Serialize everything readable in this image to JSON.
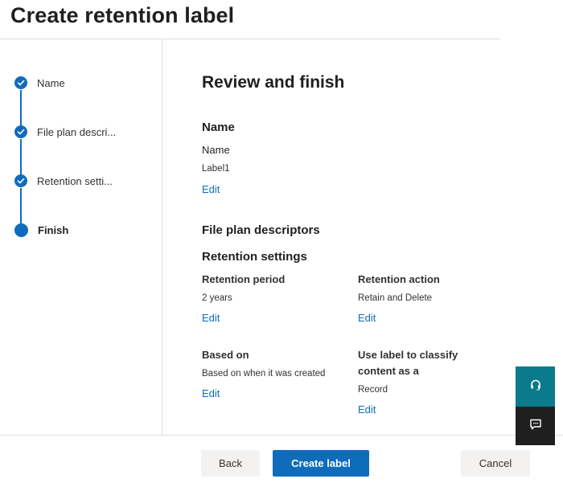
{
  "page": {
    "title": "Create retention label"
  },
  "wizard": {
    "steps": [
      {
        "label": "Name",
        "state": "completed",
        "icon": "checkmark-icon"
      },
      {
        "label": "File plan descri...",
        "state": "completed",
        "icon": "checkmark-icon"
      },
      {
        "label": "Retention setti...",
        "state": "completed",
        "icon": "checkmark-icon"
      },
      {
        "label": "Finish",
        "state": "current",
        "icon": "current-step-dot"
      }
    ]
  },
  "review": {
    "title": "Review and finish",
    "name_section": {
      "heading": "Name",
      "field_label": "Name",
      "value": "Label1",
      "edit": "Edit"
    },
    "file_plan_section": {
      "heading": "File plan descriptors"
    },
    "retention_section": {
      "heading": "Retention settings",
      "period": {
        "label": "Retention period",
        "value": "2 years",
        "edit": "Edit"
      },
      "action": {
        "label": "Retention action",
        "value": "Retain and Delete",
        "edit": "Edit"
      },
      "based_on": {
        "label": "Based on",
        "value": "Based on when it was created",
        "edit": "Edit"
      },
      "classify": {
        "label_line1": "Use label to classify",
        "label_line2": "content as a",
        "value": "Record",
        "edit": "Edit"
      }
    }
  },
  "footer": {
    "back": "Back",
    "create": "Create label",
    "cancel": "Cancel"
  },
  "side_widgets": {
    "help_icon": "headset-icon",
    "feedback_icon": "feedback-icon"
  },
  "colors": {
    "accent": "#0f6cbd",
    "help_widget": "#0b7a8c",
    "feedback_widget": "#1f1f1f",
    "secondary_button": "#f3f2f1"
  }
}
